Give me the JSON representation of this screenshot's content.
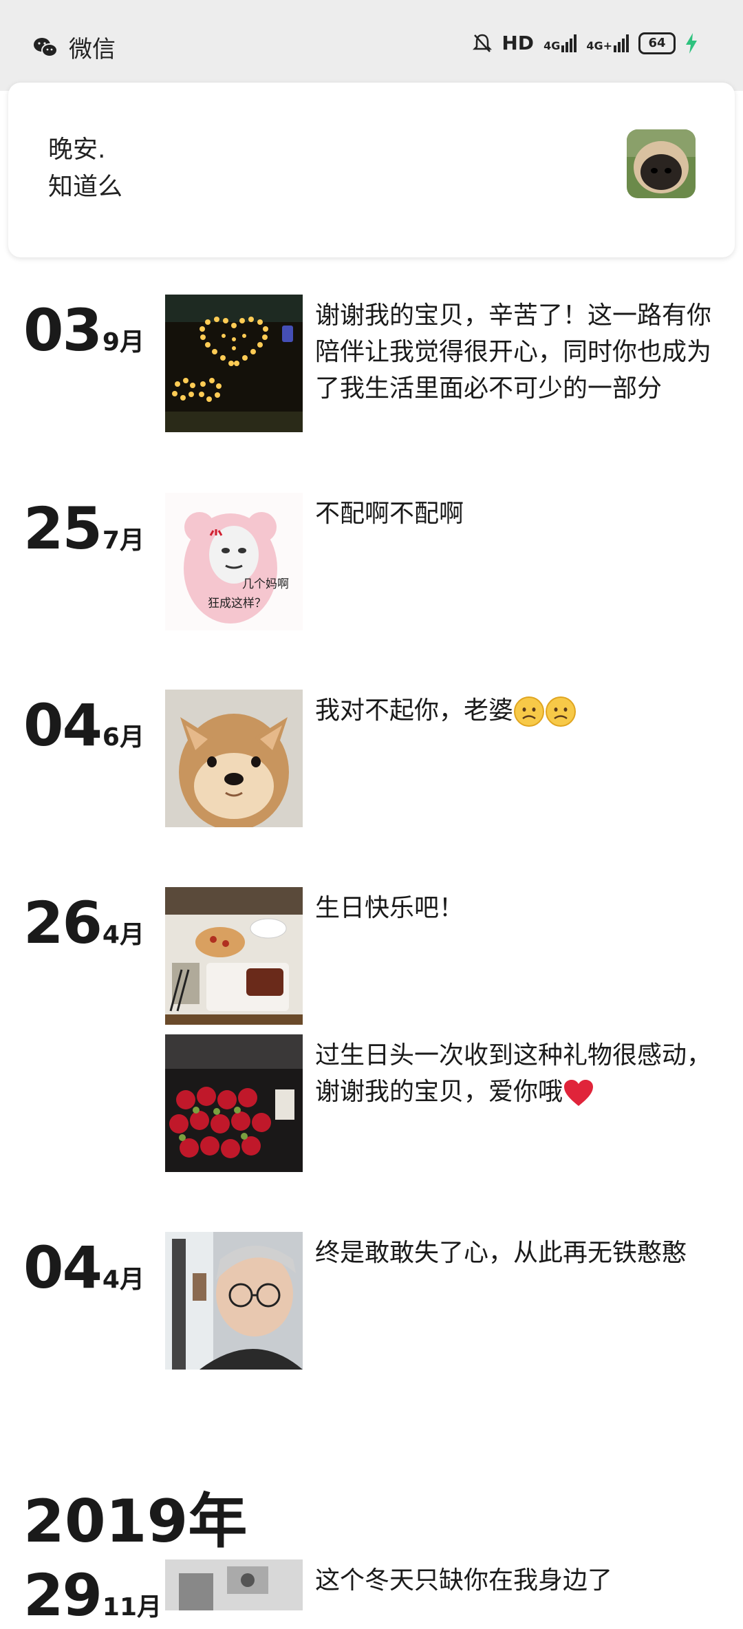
{
  "status_bar": {
    "app_name": "微信",
    "network_hd": "HD",
    "signal1": "4G",
    "signal2": "4G+",
    "battery": "64"
  },
  "notification": {
    "line1": "晚安.",
    "line2": "知道么"
  },
  "entries": [
    {
      "day": "03",
      "month": "9月",
      "text": "谢谢我的宝贝，辛苦了！这一路有你陪伴让我觉得很开心，同时你也成为了我生活里面必不可少的一部分"
    },
    {
      "day": "25",
      "month": "7月",
      "text": "不配啊不配啊",
      "meme_line1": "几个妈啊",
      "meme_line2": "狂成这样？"
    },
    {
      "day": "04",
      "month": "6月",
      "text": "我对不起你，老婆"
    },
    {
      "day": "26",
      "month": "4月",
      "text": "生日快乐吧！",
      "text2": "过生日头一次收到这种礼物很感动，谢谢我的宝贝，爱你哦"
    },
    {
      "day": "04",
      "month": "4月",
      "text": "终是敢敢失了心，从此再无铁憨憨"
    }
  ],
  "year_header": "2019年",
  "last_entry": {
    "day": "29",
    "month": "11月",
    "text": "这个冬天只缺你在我身边了"
  }
}
